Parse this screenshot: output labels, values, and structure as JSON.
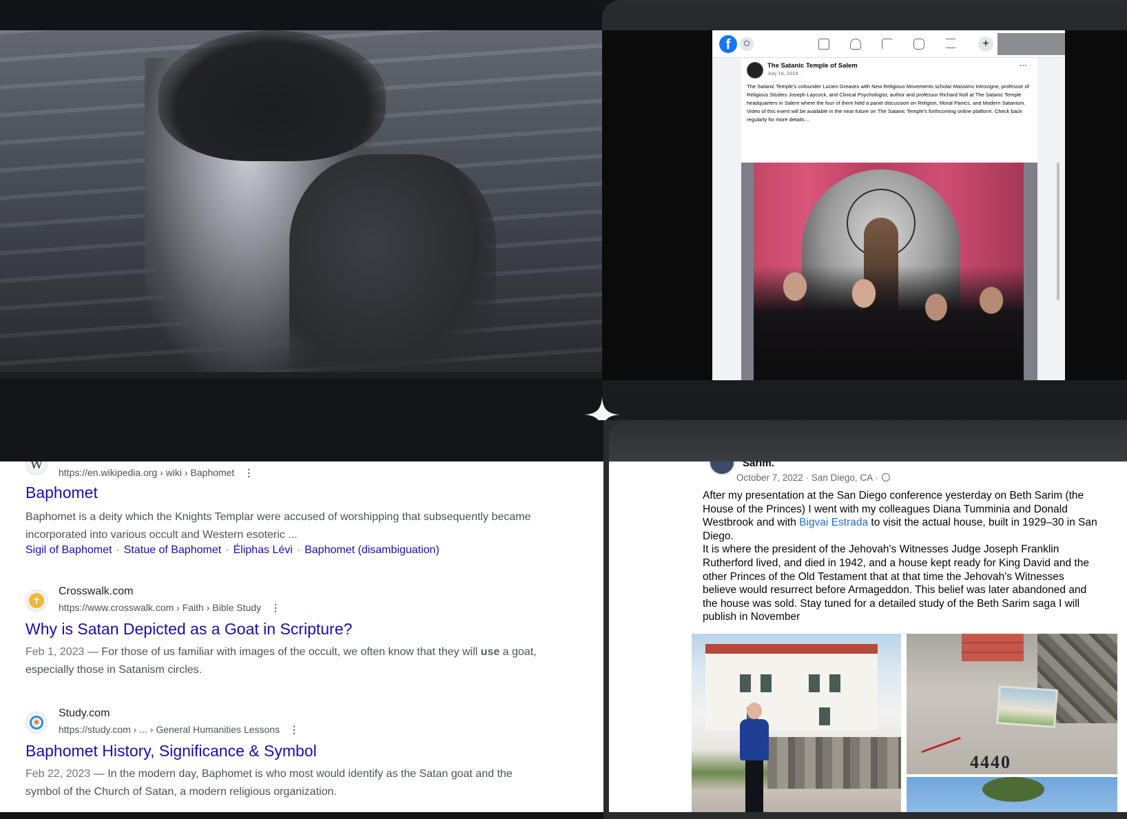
{
  "facebook_embed": {
    "logo": "f",
    "page_name": "The Satanic Temple of Salem",
    "date": "July 16, 2018 ·",
    "more": "···",
    "plus": "+",
    "post_text": "The Satanic Temple's cofounder Lucien Greaves with New Religious Movements scholar Massimo Introvigne, professor of Religious Studies Joseph Laycock, and Clinical Psychologist, author and professor Richard Noll at The Satanic Temple headquarters in Salem where the four of them held a panel discussion on Religion, Moral Panics, and Modern Satanism. Video of this event will be available in the near future on The Satanic Temple's forthcoming online platform. Check back regularly for more details....",
    "nav_icons": [
      "home-icon",
      "friends-icon",
      "flag-icon",
      "watch-icon",
      "menu-icon"
    ]
  },
  "search_results": [
    {
      "favicon": "W",
      "url": "https://en.wikipedia.org › wiki › Baphomet",
      "title": "Baphomet",
      "snippet": "Baphomet is a deity which the Knights Templar were accused of worshipping that subsequently became incorporated into various occult and Western esoteric ...",
      "sitelinks": [
        "Sigil of Baphomet",
        "Statue of Baphomet",
        "Éliphas Lévi",
        "Baphomet (disambiguation)"
      ]
    },
    {
      "favicon": "✝",
      "site_name": "Crosswalk.com",
      "url": "https://www.crosswalk.com › Faith › Bible Study",
      "title": "Why is Satan Depicted as a Goat in Scripture?",
      "date": "Feb 1, 2023",
      "snippet_a": " — For those of us familiar with images of the occult, we often know that they will ",
      "snippet_bold": "use",
      "snippet_b": " a goat, especially those in Satanism circles."
    },
    {
      "favicon": "◉",
      "site_name": "Study.com",
      "url": "https://study.com › ... › General Humanities Lessons",
      "title": "Baphomet History, Significance & Symbol",
      "date": "Feb 22, 2023",
      "snippet": " — In the modern day, Baphomet is who most would identify as the Satan goat and the symbol of the Church of Satan, a modern religious organization."
    }
  ],
  "kebab": "⋮",
  "separator": "·",
  "fb_post": {
    "author": "Sarim.",
    "meta": "October 7, 2022 · San Diego, CA · ",
    "text_a": "After my presentation at the San Diego conference yesterday on Beth Sarim (the House of the Princes) I went with my colleagues Diana Tumminia and Donald Westbrook and with ",
    "tag": "Bigvai Estrada",
    "text_b": " to visit the actual house, built in 1929–30 in San Diego.",
    "text_c": "It is where the president of the Jehovah's Witnesses Judge Joseph Franklin Rutherford lived, and died in 1942, and a house kept ready for King David and the other Princes of the Old Testament that at that time the Jehovah's Witnesses believe would resurrect before Armageddon. This belief was later abandoned and the house was sold. Stay tuned for a detailed study of the Beth Sarim saga I will publish in November",
    "house_number": "4440"
  }
}
